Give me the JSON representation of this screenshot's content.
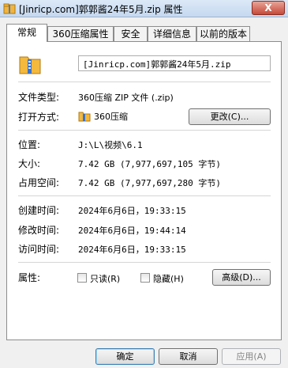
{
  "window": {
    "title": "[Jinricp.com]郭郭酱24年5月.zip 属性",
    "close_label": "X"
  },
  "tabs": [
    {
      "label": "常规"
    },
    {
      "label": "360压缩属性"
    },
    {
      "label": "安全"
    },
    {
      "label": "详细信息"
    },
    {
      "label": "以前的版本"
    }
  ],
  "general": {
    "file_name": "[Jinricp.com]郭郭酱24年5月.zip",
    "type_label": "文件类型:",
    "type_value": "360压缩 ZIP 文件 (.zip)",
    "open_with_label": "打开方式:",
    "open_with_value": "360压缩",
    "change_button": "更改(C)...",
    "location_label": "位置:",
    "location_value": "J:\\L\\视频\\6.1",
    "size_label": "大小:",
    "size_value": "7.42 GB (7,977,697,105 字节)",
    "size_on_disk_label": "占用空间:",
    "size_on_disk_value": "7.42 GB (7,977,697,280 字节)",
    "created_label": "创建时间:",
    "created_value": "2024年6月6日，19:33:15",
    "modified_label": "修改时间:",
    "modified_value": "2024年6月6日，19:44:14",
    "accessed_label": "访问时间:",
    "accessed_value": "2024年6月6日，19:33:15",
    "attributes_label": "属性:",
    "readonly_label": "只读(R)",
    "hidden_label": "隐藏(H)",
    "advanced_button": "高级(D)..."
  },
  "footer": {
    "ok": "确定",
    "cancel": "取消",
    "apply": "应用(A)"
  },
  "icons": {
    "file": "zip-archive-icon",
    "app": "folder-icon"
  }
}
